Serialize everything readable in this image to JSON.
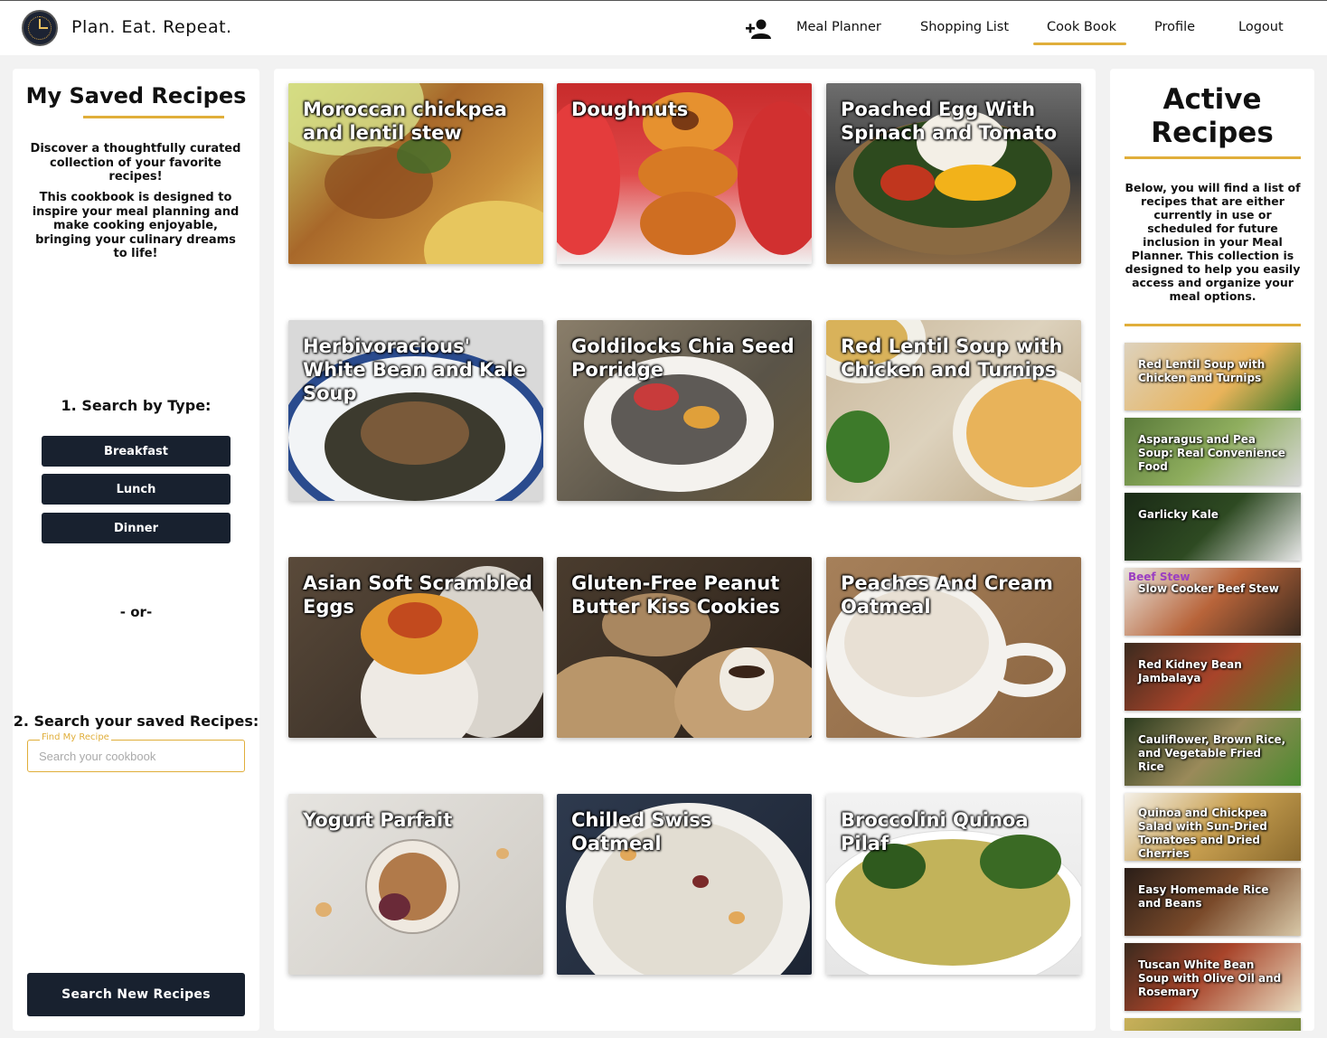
{
  "header": {
    "brand": "Plan. Eat. Repeat.",
    "logo_icon": "clock-logo-icon",
    "add_user_icon": "add-user-icon",
    "nav": [
      {
        "label": "Meal Planner"
      },
      {
        "label": "Shopping List"
      },
      {
        "label": "Cook Book",
        "active": true
      },
      {
        "label": "Profile"
      },
      {
        "label": "Logout"
      }
    ]
  },
  "left_panel": {
    "title": "My Saved Recipes",
    "intro": "Discover a thoughtfully curated collection of your favorite recipes!",
    "description": "This cookbook is designed to inspire your meal planning and make cooking enjoyable, bringing your culinary dreams to life!",
    "search_by_type_heading": "1. Search by Type:",
    "type_buttons": [
      "Breakfast",
      "Lunch",
      "Dinner"
    ],
    "or_text": "- or-",
    "search_heading": "2. Search your saved Recipes:",
    "search_label": "Find My Recipe",
    "search_placeholder": "Search your cookbook",
    "search_value": "",
    "new_search_button": "Search New Recipes"
  },
  "recipes": [
    {
      "title": "Moroccan chickpea and lentil stew"
    },
    {
      "title": "Doughnuts"
    },
    {
      "title": "Poached Egg With Spinach and Tomato"
    },
    {
      "title": "Herbivoracious' White Bean and Kale Soup"
    },
    {
      "title": "Goldilocks Chia Seed Porridge"
    },
    {
      "title": "Red Lentil Soup with Chicken and Turnips"
    },
    {
      "title": "Asian Soft Scrambled Eggs"
    },
    {
      "title": "Gluten-Free Peanut Butter Kiss Cookies"
    },
    {
      "title": "Peaches And Cream Oatmeal"
    },
    {
      "title": "Yogurt Parfait"
    },
    {
      "title": "Chilled Swiss Oatmeal"
    },
    {
      "title": "Broccolini Quinoa Pilaf"
    }
  ],
  "right_panel": {
    "title": "Active Recipes",
    "description": "Below, you will find a list of recipes that are either currently in use or scheduled for future inclusion in your Meal Planner. This collection is designed to help you easily access and organize your meal options.",
    "active_recipes": [
      {
        "title": "Red Lentil Soup with Chicken and Turnips"
      },
      {
        "title": "Asparagus and Pea Soup: Real Convenience Food"
      },
      {
        "title": "Garlicky Kale"
      },
      {
        "title": "Slow Cooker Beef Stew",
        "image_text": "Beef Stew"
      },
      {
        "title": "Red Kidney Bean Jambalaya"
      },
      {
        "title": "Cauliflower, Brown Rice, and Vegetable Fried Rice"
      },
      {
        "title": "Quinoa and Chickpea Salad with Sun-Dried Tomatoes and Dried Cherries"
      },
      {
        "title": "Easy Homemade Rice and Beans"
      },
      {
        "title": "Tuscan White Bean Soup with Olive Oil and Rosemary"
      }
    ]
  },
  "colors": {
    "accent": "#e0ae3a",
    "button_dark": "#18212f",
    "page_bg": "#f2f2f2"
  }
}
